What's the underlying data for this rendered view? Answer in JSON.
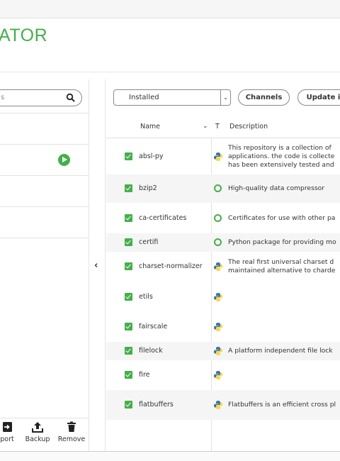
{
  "app": {
    "title_fragment": "ATOR"
  },
  "sidebar": {
    "search_placeholder": "s",
    "actions": [
      {
        "label": "port",
        "icon": "import-icon"
      },
      {
        "label": "Backup",
        "icon": "upload-icon"
      },
      {
        "label": "Remove",
        "icon": "trash-icon"
      }
    ]
  },
  "toolbar": {
    "filter_value": "Installed",
    "channels_label": "Channels",
    "update_label": "Update in"
  },
  "table": {
    "headers": {
      "name": "Name",
      "type": "T",
      "description": "Description"
    },
    "rows": [
      {
        "name": "absl-py",
        "type": "python",
        "description": [
          "This repository is a collection of",
          "applications. the code is collecte",
          "has been extensively tested and"
        ]
      },
      {
        "name": "bzip2",
        "type": "conda",
        "description": [
          "High-quality data compressor"
        ]
      },
      {
        "name": "ca-certificates",
        "type": "conda",
        "description": [
          "Certificates for use with other pa"
        ]
      },
      {
        "name": "certifi",
        "type": "conda",
        "description": [
          "Python package for providing mo"
        ]
      },
      {
        "name": "charset-normalizer",
        "type": "python",
        "description": [
          "The real first universal charset d",
          "maintained alternative to charde"
        ]
      },
      {
        "name": "etils",
        "type": "python",
        "description": []
      },
      {
        "name": "fairscale",
        "type": "python",
        "description": []
      },
      {
        "name": "filelock",
        "type": "python",
        "description": [
          "A platform independent file lock"
        ]
      },
      {
        "name": "fire",
        "type": "python",
        "description": []
      },
      {
        "name": "flatbuffers",
        "type": "python",
        "description": [
          "Flatbuffers is an efficient cross pl"
        ]
      }
    ]
  },
  "colors": {
    "accent": "#43b049",
    "python_blue": "#3776ab",
    "python_yellow": "#ffd43b"
  }
}
